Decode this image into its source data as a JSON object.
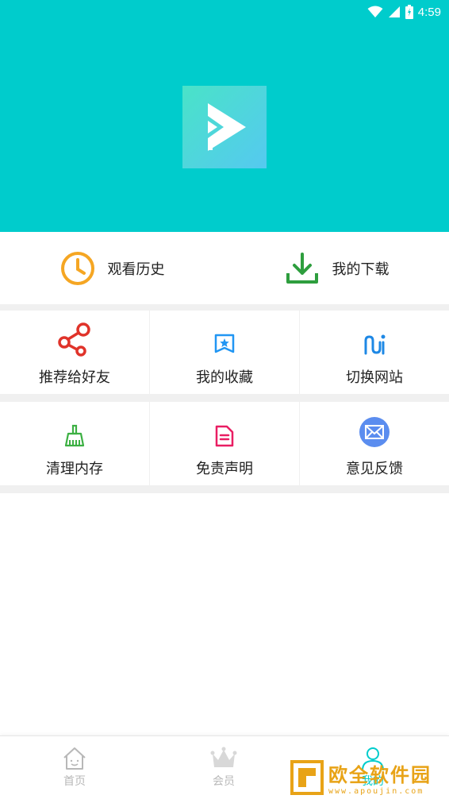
{
  "status_bar": {
    "time": "4:59",
    "icons": [
      "wifi-icon",
      "signal-icon",
      "battery-icon"
    ]
  },
  "header": {
    "background_color": "#00cccc",
    "logo_icon": "play-logo-icon"
  },
  "quick_actions": [
    {
      "label": "观看历史",
      "icon": "clock-icon",
      "color": "#f5a623"
    },
    {
      "label": "我的下载",
      "icon": "download-icon",
      "color": "#2e9e3e"
    }
  ],
  "grid": [
    {
      "label": "推荐给好友",
      "icon": "share-icon",
      "color": "#e0332a"
    },
    {
      "label": "我的收藏",
      "icon": "bookmark-star-icon",
      "color": "#2196f3"
    },
    {
      "label": "切换网站",
      "icon": "switch-icon",
      "color": "#1e88e5"
    },
    {
      "label": "清理内存",
      "icon": "broom-icon",
      "color": "#3cb043"
    },
    {
      "label": "免责声明",
      "icon": "document-icon",
      "color": "#e91e63"
    },
    {
      "label": "意见反馈",
      "icon": "mail-icon",
      "color": "#5b8def"
    }
  ],
  "bottom_nav": [
    {
      "label": "首页",
      "icon": "home-icon"
    },
    {
      "label": "会员",
      "icon": "crown-icon"
    },
    {
      "label": "我的",
      "icon": "user-icon",
      "active": true
    }
  ],
  "watermark": {
    "title": "欧全软件园",
    "url": "www.apoujin.com"
  }
}
